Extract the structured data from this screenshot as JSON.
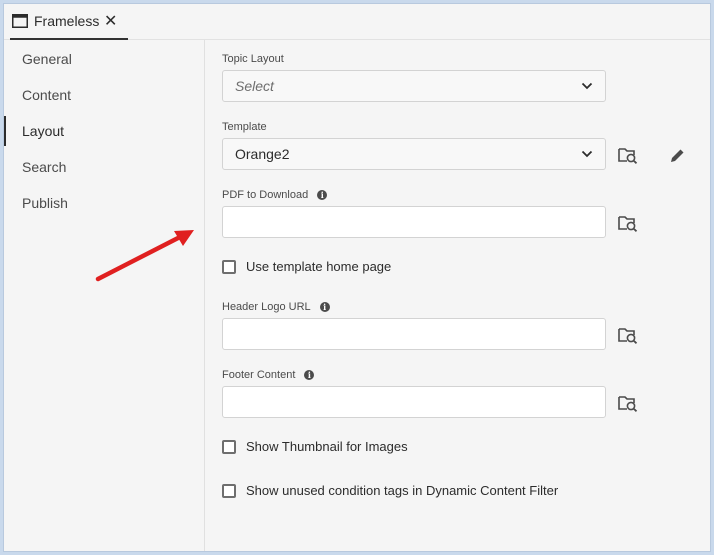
{
  "tab": {
    "label": "Frameless",
    "close": "✕"
  },
  "sidebar": {
    "items": [
      {
        "label": "General"
      },
      {
        "label": "Content"
      },
      {
        "label": "Layout"
      },
      {
        "label": "Search"
      },
      {
        "label": "Publish"
      }
    ],
    "active": "Layout"
  },
  "form": {
    "topic_layout": {
      "label": "Topic Layout",
      "placeholder": "Select"
    },
    "template": {
      "label": "Template",
      "value": "Orange2"
    },
    "pdf": {
      "label": "PDF to Download",
      "value": ""
    },
    "use_template_home": {
      "label": "Use template home page",
      "checked": false
    },
    "header_logo": {
      "label": "Header Logo URL",
      "value": ""
    },
    "footer": {
      "label": "Footer Content",
      "value": ""
    },
    "show_thumbnail": {
      "label": "Show Thumbnail for Images",
      "checked": false
    },
    "show_unused": {
      "label": "Show unused condition tags in Dynamic Content Filter",
      "checked": false
    }
  },
  "colors": {
    "annotation_arrow": "#e02020",
    "text": "#2c2c2c",
    "muted": "#4b4b4b"
  },
  "icons": {
    "tab": "window-icon",
    "browse": "folder-search-icon",
    "edit": "pencil-icon",
    "info": "info-icon",
    "dropdown": "chevron-down-icon"
  }
}
